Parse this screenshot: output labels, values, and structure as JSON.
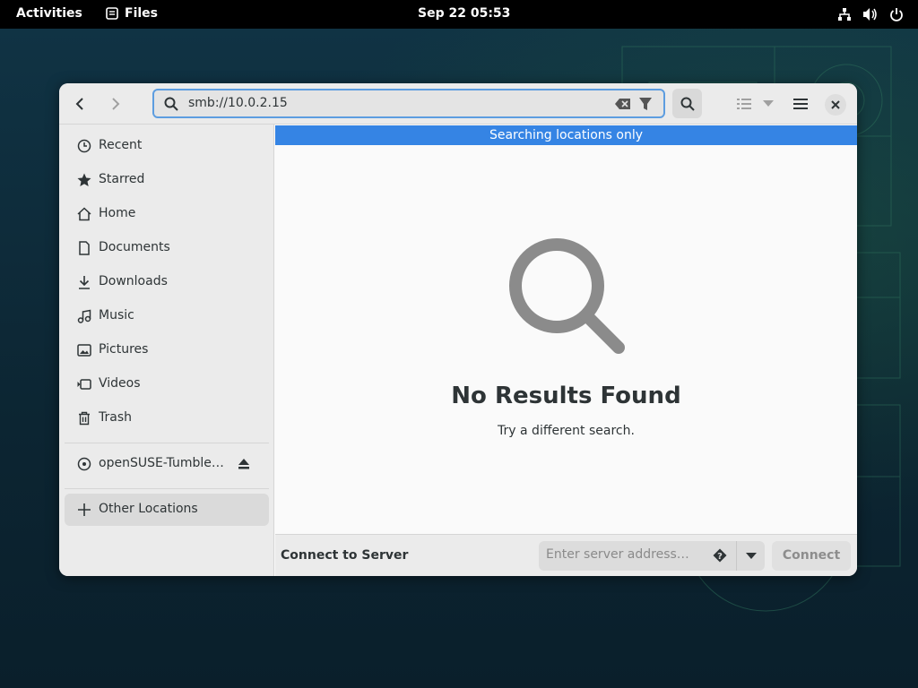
{
  "topbar": {
    "activities_label": "Activities",
    "app_name": "Files",
    "clock": "Sep 22  05:53",
    "tray_icons": [
      "network-icon",
      "volume-icon",
      "power-icon"
    ]
  },
  "window": {
    "search": {
      "value": "smb://10.0.2.15"
    },
    "banner": "Searching locations only",
    "empty_state": {
      "title": "No Results Found",
      "subtitle": "Try a different search."
    },
    "sidebar": {
      "places": [
        {
          "label": "Recent",
          "icon": "clock-icon"
        },
        {
          "label": "Starred",
          "icon": "star-icon"
        },
        {
          "label": "Home",
          "icon": "home-icon"
        },
        {
          "label": "Documents",
          "icon": "document-icon"
        },
        {
          "label": "Downloads",
          "icon": "download-icon"
        },
        {
          "label": "Music",
          "icon": "music-icon"
        },
        {
          "label": "Pictures",
          "icon": "picture-icon"
        },
        {
          "label": "Videos",
          "icon": "video-icon"
        },
        {
          "label": "Trash",
          "icon": "trash-icon"
        }
      ],
      "device": {
        "label": "openSUSE-Tumble…",
        "icon": "disc-icon"
      },
      "other_locations": {
        "label": "Other Locations",
        "icon": "plus-icon"
      }
    },
    "connect": {
      "label": "Connect to Server",
      "placeholder": "Enter server address…",
      "button": "Connect"
    }
  },
  "colors": {
    "accent": "#3584e4",
    "topbar": "#000000",
    "window_bg": "#fafafa",
    "sidebar_bg": "#ebebeb"
  }
}
